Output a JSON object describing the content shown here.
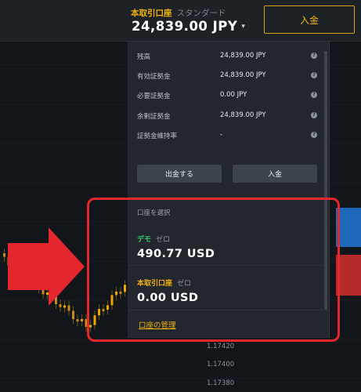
{
  "header": {
    "account_type": "本取引口座",
    "account_subtype": "スタンダード",
    "balance": "24,839.00 JPY",
    "dropdown_caret": "▾",
    "deposit_label": "入金"
  },
  "summary": {
    "rows": [
      {
        "label": "残高",
        "value": "24,839.00 JPY"
      },
      {
        "label": "有効証拠金",
        "value": "24,839.00 JPY"
      },
      {
        "label": "必要証拠金",
        "value": "0.00 JPY"
      },
      {
        "label": "余剰証拠金",
        "value": "24,839.00 JPY"
      },
      {
        "label": "証拠金維持率",
        "value": "-"
      }
    ],
    "help_glyph": "?",
    "withdraw_label": "出金する",
    "deposit_label": "入金"
  },
  "account_select": {
    "title": "口座を選択",
    "accounts": [
      {
        "tag": "デモ",
        "sub": "ゼロ",
        "amount": "490.77 USD",
        "tag_color": "#35c96b"
      },
      {
        "tag": "本取引口座",
        "sub": "ゼロ",
        "amount": "0.00 USD",
        "tag_color": "#f3b30a"
      }
    ],
    "manage_label": "口座の管理"
  },
  "chart": {
    "price_labels": [
      "1.17420",
      "1.17400",
      "1.17380"
    ],
    "colors": {
      "up": "#f0a500",
      "down": "#c7891d",
      "buy": "#1f67b8",
      "sell": "#b52b2b"
    }
  },
  "annotation": {
    "box_color": "#e4262d",
    "arrow_color": "#e4262d"
  }
}
